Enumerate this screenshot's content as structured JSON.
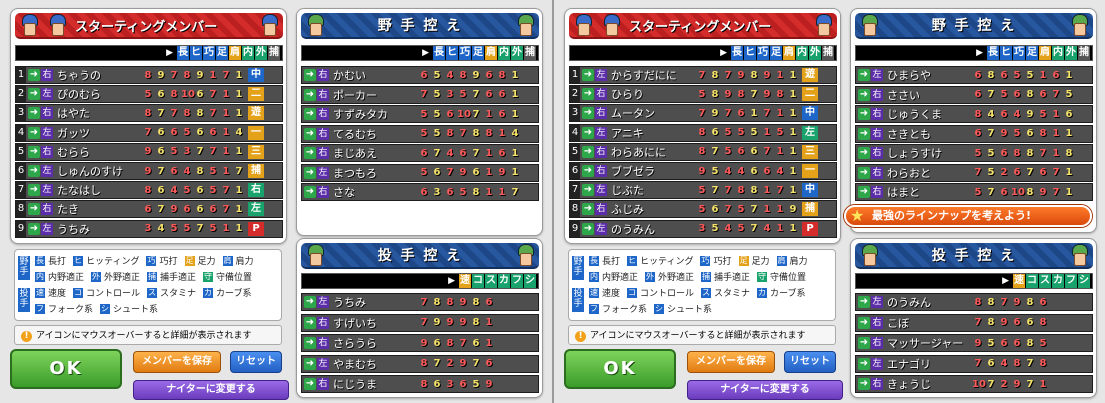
{
  "headers": {
    "starting": "スターティングメンバー",
    "bench": "野 手 控 え",
    "pitchers": "投 手 控 え",
    "batter_stats": [
      "長",
      "ヒ",
      "巧",
      "足",
      "肩",
      "内",
      "外",
      "捕"
    ],
    "pitcher_stats": [
      "速",
      "コ",
      "ス",
      "カ",
      "フ",
      "シ"
    ]
  },
  "legend": {
    "fielder_side": "野手",
    "pitcher_side": "投手",
    "row1": [
      [
        "長",
        "長打"
      ],
      [
        "ヒ",
        "ヒッティング"
      ],
      [
        "巧",
        "巧打"
      ],
      [
        "足",
        "足力"
      ],
      [
        "肩",
        "肩力"
      ]
    ],
    "row2": [
      [
        "内",
        "内野適正"
      ],
      [
        "外",
        "外野適正"
      ],
      [
        "捕",
        "捕手適正"
      ],
      [
        "守",
        "守備位置"
      ]
    ],
    "row3": [
      [
        "速",
        "速度"
      ],
      [
        "コ",
        "コントロール"
      ],
      [
        "ス",
        "スタミナ"
      ],
      [
        "カ",
        "カーブ系"
      ]
    ],
    "row4": [
      [
        "フ",
        "フォーク系"
      ],
      [
        "シ",
        "シュート系"
      ]
    ]
  },
  "note": "アイコンにマウスオーバーすると詳細が表示されます",
  "buttons": {
    "ok": "OK",
    "save": "メンバーを保存",
    "reset": "リセット",
    "night": "ナイターに変更する"
  },
  "promo": "最強のラインナップを考えよう!",
  "left": {
    "starting": [
      {
        "n": "1",
        "h": "右",
        "name": "ちゃうの",
        "s": "8 9 7 8 9 1 7 1",
        "pos": "中"
      },
      {
        "n": "2",
        "h": "左",
        "name": "ぴのむら",
        "s": "5 6 8 10 6 7 1 1",
        "pos": "二"
      },
      {
        "n": "3",
        "h": "右",
        "name": "はやた",
        "s": "8 7 7 8 8 7 1 1",
        "pos": "遊"
      },
      {
        "n": "4",
        "h": "左",
        "name": "ガッツ",
        "s": "7 6 6 5 6 6 1 4",
        "pos": "一"
      },
      {
        "n": "5",
        "h": "右",
        "name": "むらら",
        "s": "9 6 5 3 7 7 1 1",
        "pos": "三"
      },
      {
        "n": "6",
        "h": "左",
        "name": "しゅんのすけ",
        "s": "9 7 6 4 8 5 1 7",
        "pos": "捕"
      },
      {
        "n": "7",
        "h": "左",
        "name": "たなはし",
        "s": "8 6 4 5 6 5 7 1",
        "pos": "右"
      },
      {
        "n": "8",
        "h": "右",
        "name": "たき",
        "s": "6 7 9 6 6 6 7 1",
        "pos": "左"
      },
      {
        "n": "9",
        "h": "左",
        "name": "うちみ",
        "s": "3 4 5 5 7 5 1 1",
        "pos": "P"
      }
    ],
    "bench": [
      {
        "h": "右",
        "name": "かむい",
        "s": "6 5 4 8 9 6 8 1"
      },
      {
        "h": "右",
        "name": "ポーカー",
        "s": "7 5 3 5 7 6 6 1"
      },
      {
        "h": "右",
        "name": "すずみタカ",
        "s": "5 5 6 10 7 1 6 1"
      },
      {
        "h": "右",
        "name": "てるむち",
        "s": "5 5 8 7 8 8 1 4"
      },
      {
        "h": "右",
        "name": "まじあえ",
        "s": "6 7 4 6 7 1 6 1"
      },
      {
        "h": "左",
        "name": "まつもろ",
        "s": "5 6 7 9 6 1 9 1"
      },
      {
        "h": "右",
        "name": "さな",
        "s": "6 3 6 5 8 1 1 7"
      }
    ],
    "pitchers": [
      {
        "h": "左",
        "name": "うちみ",
        "s": "7 8 8 9 8 6"
      },
      {
        "h": "右",
        "name": "すげいち",
        "s": "7 9 9 9 8 1"
      },
      {
        "h": "右",
        "name": "さらうら",
        "s": "9 6 8 7 6 1"
      },
      {
        "h": "左",
        "name": "やまむち",
        "s": "8 7 2 9 7 6"
      },
      {
        "h": "右",
        "name": "にじうま",
        "s": "8 6 3 6 5 9"
      }
    ]
  },
  "right": {
    "starting": [
      {
        "n": "1",
        "h": "左",
        "name": "からすだにに",
        "s": "7 8 7 9 8 9 1 1",
        "pos": "遊"
      },
      {
        "n": "2",
        "h": "右",
        "name": "ひらり",
        "s": "5 8 9 8 7 9 8 1",
        "pos": "二"
      },
      {
        "n": "3",
        "h": "右",
        "name": "ムータン",
        "s": "7 9 7 6 1 7 1 1",
        "pos": "中"
      },
      {
        "n": "4",
        "h": "左",
        "name": "アニキ",
        "s": "8 6 5 5 5 1 5 1",
        "pos": "左"
      },
      {
        "n": "5",
        "h": "右",
        "name": "わらあにに",
        "s": "8 7 5 6 6 7 1 1",
        "pos": "三"
      },
      {
        "n": "6",
        "h": "右",
        "name": "ブブゼラ",
        "s": "9 5 4 4 6 6 4 1",
        "pos": "一"
      },
      {
        "n": "7",
        "h": "左",
        "name": "じぶた",
        "s": "5 7 7 8 8 1 7 1",
        "pos": "中"
      },
      {
        "n": "8",
        "h": "右",
        "name": "ふじみ",
        "s": "5 6 7 5 7 1 1 9",
        "pos": "捕"
      },
      {
        "n": "9",
        "h": "左",
        "name": "のうみん",
        "s": "3 5 4 5 7 4 1 1",
        "pos": "P"
      }
    ],
    "bench": [
      {
        "h": "左",
        "name": "ひまらや",
        "s": "6 8 6 5 5 1 6 1"
      },
      {
        "h": "右",
        "name": "ささい",
        "s": "6 7 5 6 8 6 7 5"
      },
      {
        "h": "右",
        "name": "じゅうくま",
        "s": "8 4 6 4 9 5 1 6"
      },
      {
        "h": "右",
        "name": "さきとも",
        "s": "6 7 9 5 6 8 1 1"
      },
      {
        "h": "右",
        "name": "しょうすけ",
        "s": "5 5 6 8 8 7 1 8"
      },
      {
        "h": "右",
        "name": "わらおと",
        "s": "7 5 2 6 7 6 7 1"
      },
      {
        "h": "右",
        "name": "はまと",
        "s": "5 7 6 10 8 9 7 1"
      }
    ],
    "pitchers": [
      {
        "h": "左",
        "name": "のうみん",
        "s": "8 8 7 9 8 6"
      },
      {
        "h": "右",
        "name": "こぼ",
        "s": "7 8 9 6 6 8"
      },
      {
        "h": "右",
        "name": "マッサージャー",
        "s": "9 5 6 6 8 5"
      },
      {
        "h": "左",
        "name": "エナゴリ",
        "s": "7 6 4 8 7 8"
      },
      {
        "h": "右",
        "name": "きょうじ",
        "s": "10 7 2 9 7 1"
      }
    ]
  }
}
